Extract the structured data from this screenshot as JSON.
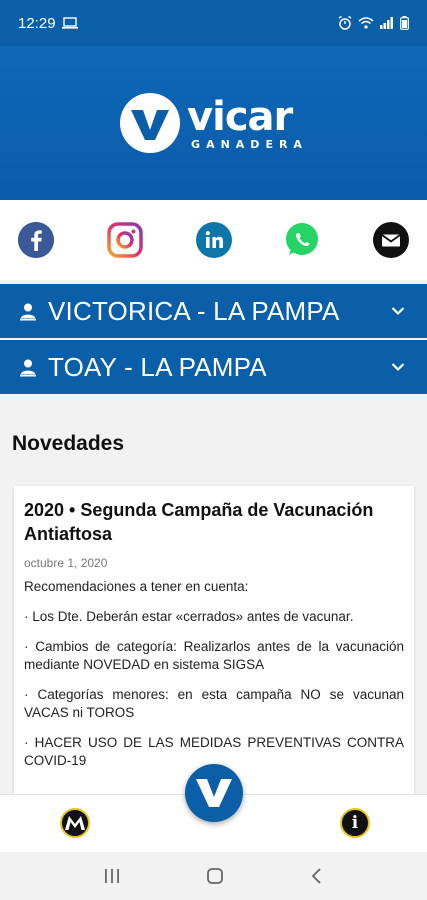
{
  "status_bar": {
    "time": "12:29"
  },
  "brand": {
    "name": "vicar",
    "subtitle": "GANADERA"
  },
  "social": [
    {
      "name": "facebook-icon",
      "color": "#3b5998"
    },
    {
      "name": "instagram-icon",
      "color": "#c13584"
    },
    {
      "name": "linkedin-icon",
      "color": "#0e76a8"
    },
    {
      "name": "whatsapp-icon",
      "color": "#25d366"
    },
    {
      "name": "email-icon",
      "color": "#111111"
    }
  ],
  "locations": [
    {
      "label": "VICTORICA - LA PAMPA"
    },
    {
      "label": "TOAY - LA PAMPA"
    }
  ],
  "news": {
    "section_title": "Novedades",
    "post": {
      "title": "2020 • Segunda Campaña de Vacunación Antiaftosa",
      "date": "octubre 1, 2020",
      "paragraphs": [
        "Recomendaciones a tener en cuenta:",
        "· Los Dte. Deberán estar «cerrados» antes de vacunar.",
        "· Cambios de categoría: Realizarlos antes de la vacunación mediante NOVEDAD en sistema SIGSA",
        "· Categorías menores: en esta campaña NO se vacunan VACAS ni TOROS",
        "· HACER USO DE LAS MEDIDAS PREVENTIVAS CONTRA COVID-19"
      ]
    }
  },
  "colors": {
    "primary": "#0b5ea8",
    "accent": "#e9c31e"
  }
}
